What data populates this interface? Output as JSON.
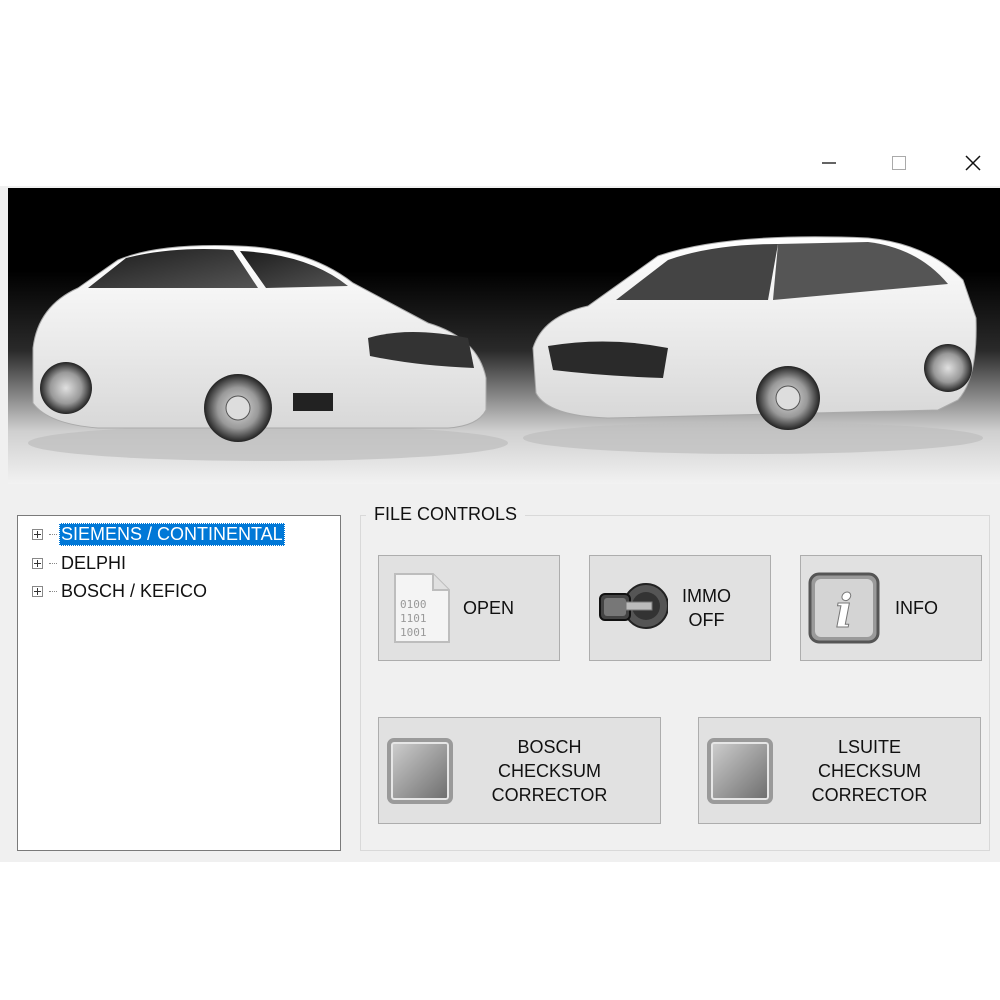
{
  "window": {
    "controls": {
      "minimize": "—",
      "maximize": "☐",
      "close": "✕"
    }
  },
  "tree": {
    "items": [
      {
        "label": "SIEMENS / CONTINENTAL",
        "selected": true
      },
      {
        "label": "DELPHI",
        "selected": false
      },
      {
        "label": "BOSCH / KEFICO",
        "selected": false
      }
    ]
  },
  "file_controls": {
    "title": "FILE CONTROLS",
    "open_label": "OPEN",
    "open_icon_text": "0100\n1101\n1001",
    "immo_label": "IMMO\nOFF",
    "info_label": "INFO",
    "bosch_label": "BOSCH\nCHECKSUM\nCORRECTOR",
    "lsuite_label": "LSUITE\nCHECKSUM\nCORRECTOR"
  },
  "colors": {
    "selection": "#0078d7",
    "button_face": "#e1e1e1"
  }
}
